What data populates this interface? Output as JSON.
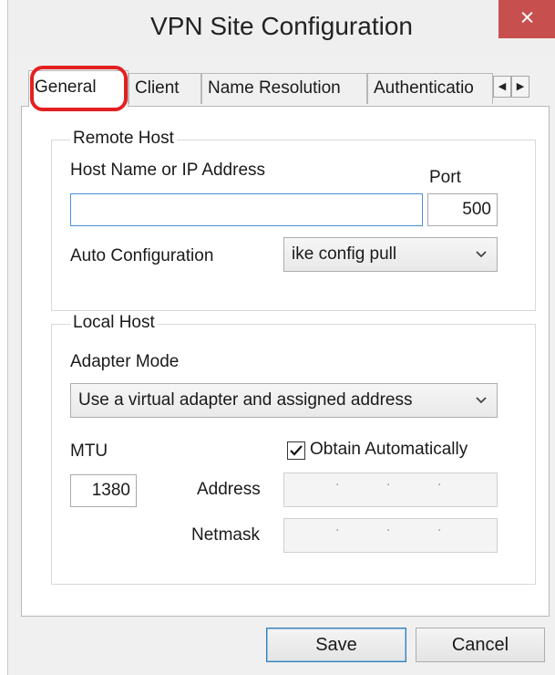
{
  "window": {
    "title": "VPN Site Configuration",
    "close_glyph": "×"
  },
  "tabs": [
    {
      "label": "General",
      "active": true
    },
    {
      "label": "Client"
    },
    {
      "label": "Name Resolution"
    },
    {
      "label": "Authenticatio"
    }
  ],
  "tab_scroll": {
    "left_icon": "◀",
    "right_icon": "▶"
  },
  "remote_host": {
    "group_label": "Remote Host",
    "host_label": "Host Name or IP Address",
    "host_value": "",
    "port_label": "Port",
    "port_value": "500",
    "auto_config_label": "Auto Configuration",
    "auto_config_value": "ike config pull"
  },
  "local_host": {
    "group_label": "Local Host",
    "adapter_mode_label": "Adapter Mode",
    "adapter_mode_value": "Use a virtual adapter and assigned address",
    "mtu_label": "MTU",
    "mtu_value": "1380",
    "obtain_auto_label": "Obtain Automatically",
    "obtain_auto_checked": true,
    "address_label": "Address",
    "netmask_label": "Netmask"
  },
  "buttons": {
    "save": "Save",
    "cancel": "Cancel"
  },
  "colors": {
    "highlight": "#e32020",
    "close": "#c7504f",
    "focus": "#4a90d9"
  },
  "icons": {
    "dropdown": "chevron-down-icon",
    "check": "checkmark-icon"
  }
}
